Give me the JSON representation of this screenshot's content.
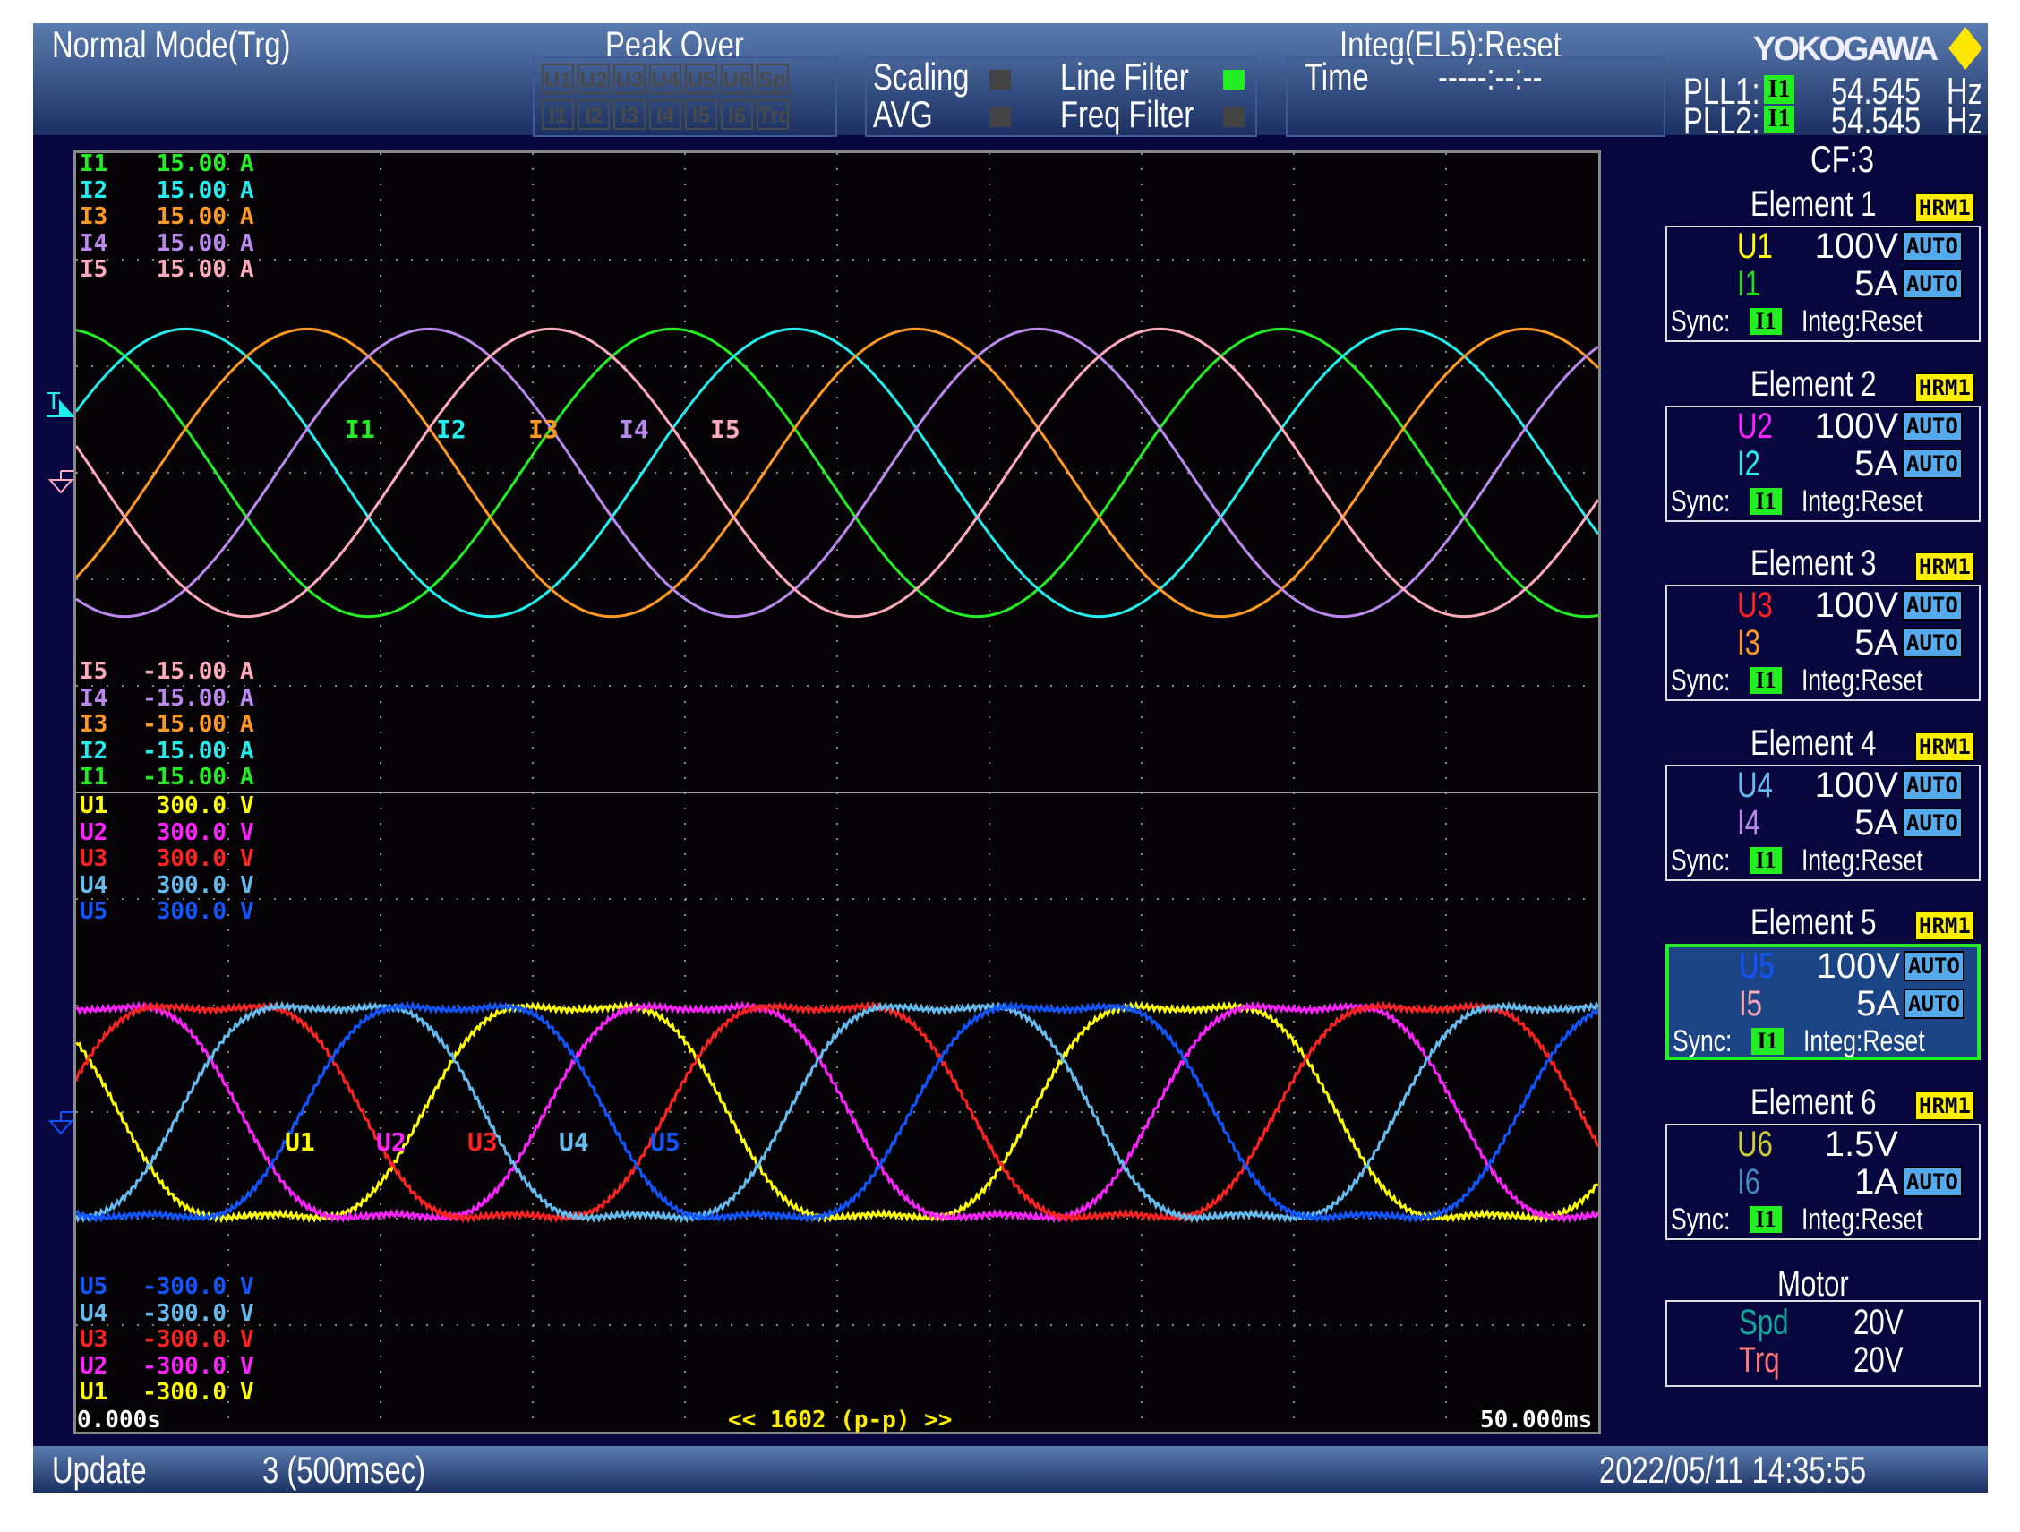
{
  "header": {
    "mode": "Normal Mode(Trg)",
    "peak_over_title": "Peak Over",
    "peak_over_u": [
      "U1",
      "U2",
      "U3",
      "U4",
      "U5",
      "U6",
      "Spd"
    ],
    "peak_over_i": [
      "I1",
      "I2",
      "I3",
      "I4",
      "I5",
      "I6",
      "Trq"
    ],
    "scaling_label": "Scaling",
    "avg_label": "AVG",
    "line_filter_label": "Line Filter",
    "freq_filter_label": "Freq Filter",
    "line_filter_on": true,
    "integ_status": "Integ(EL5):Reset",
    "time_label": "Time",
    "time_value": "-----:--:--",
    "logo": "YOKOGAWA",
    "pll1_label": "PLL1:",
    "pll1_src": "I1",
    "pll1_value": "54.545",
    "pll2_label": "PLL2:",
    "pll2_src": "I1",
    "pll2_value": "54.545",
    "hz": "Hz",
    "cf": "CF:3"
  },
  "elements": [
    {
      "title": "Element 1",
      "badge": "HRM1",
      "u": "U1",
      "u_color": "#ffff00",
      "u_range": "100V",
      "u_auto": "AUTO",
      "i": "I1",
      "i_color": "#22dd22",
      "i_range": "5A",
      "i_auto": "AUTO",
      "sync_label": "Sync:",
      "sync": "I1",
      "integ": "Integ:Reset",
      "selected": false
    },
    {
      "title": "Element 2",
      "badge": "HRM1",
      "u": "U2",
      "u_color": "#ff22ff",
      "u_range": "100V",
      "u_auto": "AUTO",
      "i": "I2",
      "i_color": "#22eeee",
      "i_range": "5A",
      "i_auto": "AUTO",
      "sync_label": "Sync:",
      "sync": "I1",
      "integ": "Integ:Reset",
      "selected": false
    },
    {
      "title": "Element 3",
      "badge": "HRM1",
      "u": "U3",
      "u_color": "#ff2222",
      "u_range": "100V",
      "u_auto": "AUTO",
      "i": "I3",
      "i_color": "#ff9922",
      "i_range": "5A",
      "i_auto": "AUTO",
      "sync_label": "Sync:",
      "sync": "I1",
      "integ": "Integ:Reset",
      "selected": false
    },
    {
      "title": "Element 4",
      "badge": "HRM1",
      "u": "U4",
      "u_color": "#66bbee",
      "u_range": "100V",
      "u_auto": "AUTO",
      "i": "I4",
      "i_color": "#bb88ee",
      "i_range": "5A",
      "i_auto": "AUTO",
      "sync_label": "Sync:",
      "sync": "I1",
      "integ": "Integ:Reset",
      "selected": false
    },
    {
      "title": "Element 5",
      "badge": "HRM1",
      "u": "U5",
      "u_color": "#1155ff",
      "u_range": "100V",
      "u_auto": "AUTO",
      "i": "I5",
      "i_color": "#ffaabb",
      "i_range": "5A",
      "i_auto": "AUTO",
      "sync_label": "Sync:",
      "sync": "I1",
      "integ": "Integ:Reset",
      "selected": true
    },
    {
      "title": "Element 6",
      "badge": "HRM1",
      "u": "U6",
      "u_color": "#cccc33",
      "u_range": "1.5V",
      "u_auto": "",
      "i": "I6",
      "i_color": "#4488bb",
      "i_range": "1A",
      "i_auto": "AUTO",
      "sync_label": "Sync:",
      "sync": "I1",
      "integ": "Integ:Reset",
      "selected": false
    }
  ],
  "motor": {
    "title": "Motor",
    "spd": "Spd",
    "spd_color": "#11aa99",
    "spd_range": "20V",
    "trq": "Trq",
    "trq_color": "#ff7777",
    "trq_range": "20V"
  },
  "scope": {
    "current_top": [
      {
        "name": "I1",
        "value": "15.00",
        "unit": "A",
        "color": "#22ee22"
      },
      {
        "name": "I2",
        "value": "15.00",
        "unit": "A",
        "color": "#22eeee"
      },
      {
        "name": "I3",
        "value": "15.00",
        "unit": "A",
        "color": "#ff9922"
      },
      {
        "name": "I4",
        "value": "15.00",
        "unit": "A",
        "color": "#bb88ee"
      },
      {
        "name": "I5",
        "value": "15.00",
        "unit": "A",
        "color": "#ffaabb"
      }
    ],
    "current_bottom": [
      {
        "name": "I5",
        "value": "-15.00",
        "unit": "A",
        "color": "#ffaabb"
      },
      {
        "name": "I4",
        "value": "-15.00",
        "unit": "A",
        "color": "#bb88ee"
      },
      {
        "name": "I3",
        "value": "-15.00",
        "unit": "A",
        "color": "#ff9922"
      },
      {
        "name": "I2",
        "value": "-15.00",
        "unit": "A",
        "color": "#22eeee"
      },
      {
        "name": "I1",
        "value": "-15.00",
        "unit": "A",
        "color": "#22ee22"
      }
    ],
    "voltage_top": [
      {
        "name": "U1",
        "value": "300.0",
        "unit": "V",
        "color": "#ffff00"
      },
      {
        "name": "U2",
        "value": "300.0",
        "unit": "V",
        "color": "#ff22ff"
      },
      {
        "name": "U3",
        "value": "300.0",
        "unit": "V",
        "color": "#ff2222"
      },
      {
        "name": "U4",
        "value": "300.0",
        "unit": "V",
        "color": "#66bbee"
      },
      {
        "name": "U5",
        "value": "300.0",
        "unit": "V",
        "color": "#1155ff"
      }
    ],
    "voltage_bottom": [
      {
        "name": "U5",
        "value": "-300.0",
        "unit": "V",
        "color": "#1155ff"
      },
      {
        "name": "U4",
        "value": "-300.0",
        "unit": "V",
        "color": "#66bbee"
      },
      {
        "name": "U3",
        "value": "-300.0",
        "unit": "V",
        "color": "#ff2222"
      },
      {
        "name": "U2",
        "value": "-300.0",
        "unit": "V",
        "color": "#ff22ff"
      },
      {
        "name": "U1",
        "value": "-300.0",
        "unit": "V",
        "color": "#ffff00"
      }
    ],
    "time_start": "0.000s",
    "time_end": "50.000ms",
    "points": "<< 1602 (p-p) >>",
    "trigger_marker": "T"
  },
  "chart_data": {
    "type": "line",
    "xlim_ms": [
      0,
      50
    ],
    "grid": true,
    "panels": [
      {
        "quantity": "current",
        "unit": "A",
        "ylim": [
          -15,
          15
        ],
        "series": [
          {
            "name": "I1",
            "color": "#22ee22",
            "waveform": "sine",
            "amplitude": 6.75,
            "period_ms": 20,
            "peak_time_ms": 19.6
          },
          {
            "name": "I2",
            "color": "#22eeee",
            "waveform": "sine",
            "amplitude": 6.75,
            "period_ms": 20,
            "peak_time_ms": 3.6
          },
          {
            "name": "I3",
            "color": "#ff9922",
            "waveform": "sine",
            "amplitude": 6.75,
            "period_ms": 20,
            "peak_time_ms": 7.6
          },
          {
            "name": "I4",
            "color": "#bb88ee",
            "waveform": "sine",
            "amplitude": 6.75,
            "period_ms": 20,
            "peak_time_ms": 11.6
          },
          {
            "name": "I5",
            "color": "#ffaabb",
            "waveform": "sine",
            "amplitude": 6.75,
            "period_ms": 20,
            "peak_time_ms": 15.6
          }
        ]
      },
      {
        "quantity": "voltage",
        "unit": "V",
        "ylim": [
          -300,
          300
        ],
        "series": [
          {
            "name": "U1",
            "color": "#ffff00",
            "waveform": "flat-top",
            "amplitude": 96,
            "period_ms": 20,
            "peak_time_ms": 16.4
          },
          {
            "name": "U2",
            "color": "#ff22ff",
            "waveform": "flat-top",
            "amplitude": 96,
            "period_ms": 20,
            "peak_time_ms": 0.4
          },
          {
            "name": "U3",
            "color": "#ff2222",
            "waveform": "flat-top",
            "amplitude": 96,
            "period_ms": 20,
            "peak_time_ms": 4.4
          },
          {
            "name": "U4",
            "color": "#66bbee",
            "waveform": "flat-top",
            "amplitude": 96,
            "period_ms": 20,
            "peak_time_ms": 8.4
          },
          {
            "name": "U5",
            "color": "#1155ff",
            "waveform": "flat-top",
            "amplitude": 96,
            "period_ms": 20,
            "peak_time_ms": 12.4
          }
        ]
      }
    ]
  },
  "footer": {
    "update_label": "Update",
    "update_value": "3 (500msec)",
    "datetime": "2022/05/11 14:35:55"
  }
}
